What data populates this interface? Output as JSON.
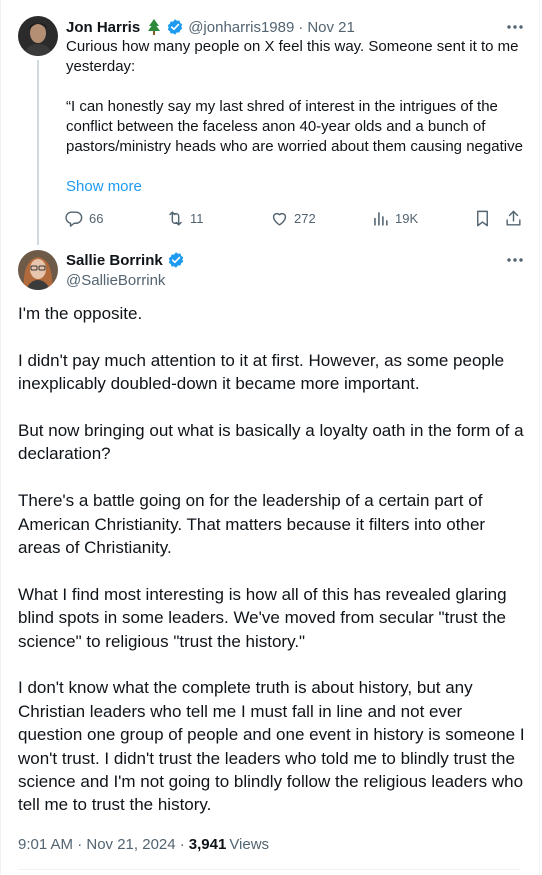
{
  "parent_tweet": {
    "author_name": "Jon Harris",
    "author_handle": "@jonharris1989",
    "separator": "·",
    "date": "Nov 21",
    "text": [
      "Curious how many people on X feel this way. Someone sent it to me yesterday:",
      "“I can honestly say my last shred of interest in the intrigues of the conflict between the faceless anon 40-year olds and a bunch of pastors/ministry heads who are worried about them causing negative"
    ],
    "show_more": "Show more",
    "stats": {
      "replies": "66",
      "reposts": "11",
      "likes": "272",
      "views": "19K"
    }
  },
  "main_tweet": {
    "author_name": "Sallie Borrink",
    "author_handle": "@SallieBorrink",
    "paragraphs": [
      "I'm the opposite.",
      "I didn't pay much attention to it at first. However, as some people inexplicably doubled-down it became more important.",
      "But now bringing out what is basically a loyalty oath in the form of a declaration?",
      "There's a battle going on for the leadership of a certain part of American Christianity. That matters because it filters into other areas of Christianity.",
      "What I find most interesting is how all of this has revealed glaring blind spots in some leaders. We've moved from secular \"trust the science\" to religious \"trust the history.\"",
      "I don't know what the complete truth is about history, but any Christian leaders who tell me I must fall in line and not ever question one group of people and one event in history is someone I won't trust. I didn't trust the leaders who told me to blindly trust the science and I'm not going to blindly follow the religious leaders who tell me to trust the history."
    ],
    "timestamp": "9:01 AM · Nov 21, 2024 ·",
    "views_count": "3,941",
    "views_label": "Views"
  },
  "colors": {
    "accent": "#1d9bf0",
    "text_primary": "#0f1419",
    "text_secondary": "#536471",
    "divider": "#eff3f4"
  },
  "icons": [
    "tree-icon",
    "verified-badge-icon",
    "more-icon",
    "reply-icon",
    "repost-icon",
    "like-icon",
    "views-icon",
    "bookmark-icon",
    "share-icon"
  ]
}
